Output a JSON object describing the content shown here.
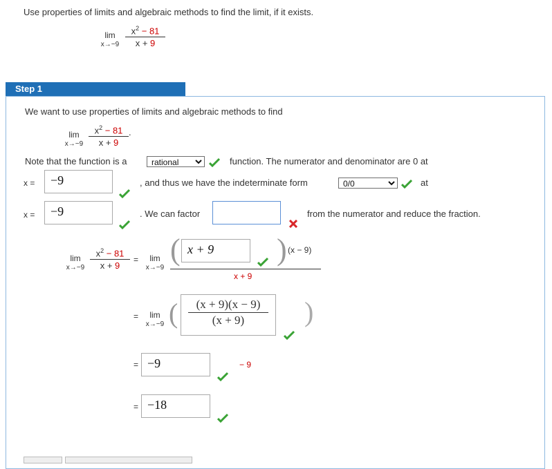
{
  "question": {
    "prompt": "Use properties of limits and algebraic methods to find the limit, if it exists.",
    "lim": "lim",
    "sub": "x→−9",
    "numerator": "x",
    "numerator_exp": "2",
    "numerator_rest": "− 81",
    "denominator_x": "x +",
    "denominator_const": "9"
  },
  "step": {
    "header": "Step 1",
    "intro": "We want to use properties of limits and algebraic methods to find",
    "intro_period": ".",
    "note_before": "Note that the function is a",
    "function_type_selected": "rational",
    "note_after": "function. The numerator and denominator are 0 at",
    "x_eq": "x =",
    "answer_x1": "−9",
    "indeterminate_text": ", and thus we have the indeterminate form",
    "indeterminate_selected": "0/0",
    "at": "at",
    "answer_x2": "−9",
    "factor_text": ". We can factor",
    "factor_input": "",
    "factor_after": "from the numerator and reduce the fraction.",
    "eq": "=",
    "paren_answer": "x + 9",
    "x_minus_9": "(x − 9)",
    "den_x9": "x + 9",
    "reduced_num": "(x + 9)(x − 9)",
    "reduced_den": "(x + 9)",
    "answer_minus9": "−9",
    "minus9_red": "− 9",
    "answer_final": "−18"
  },
  "colors": {
    "accent": "#1f6fb6",
    "check": "#3aa335",
    "error": "#d9262a",
    "red_text": "#cc0000"
  },
  "icons": [
    "check-icon",
    "x-icon"
  ]
}
